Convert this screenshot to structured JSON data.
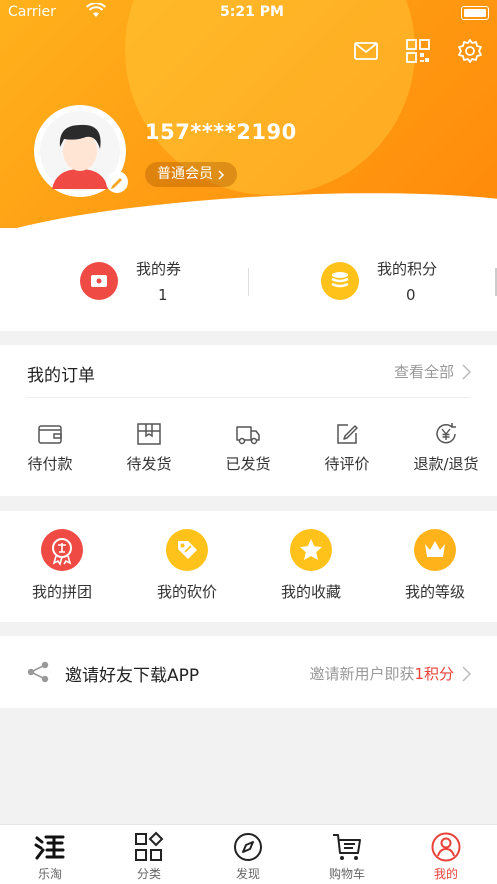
{
  "status_bar": {
    "carrier": "Carrier",
    "time": "5:21 PM"
  },
  "header": {
    "icons": [
      "mail-icon",
      "qr-code-icon",
      "settings-icon"
    ]
  },
  "profile": {
    "phone": "157****2190",
    "member_level": "普通会员"
  },
  "stats": [
    {
      "label": "我的券",
      "value": "1",
      "icon": "coupon-icon",
      "color": "#f04a45"
    },
    {
      "label": "我的积分",
      "value": "0",
      "icon": "coin-icon",
      "color": "#ffc21a"
    }
  ],
  "orders": {
    "title": "我的订单",
    "view_all": "查看全部",
    "items": [
      {
        "label": "待付款",
        "icon": "wallet-icon"
      },
      {
        "label": "待发货",
        "icon": "package-icon"
      },
      {
        "label": "已发货",
        "icon": "truck-icon"
      },
      {
        "label": "待评价",
        "icon": "edit-icon"
      },
      {
        "label": "退款/退货",
        "icon": "refund-icon"
      }
    ]
  },
  "features": [
    {
      "label": "我的拼团",
      "icon": "group-buy-icon",
      "color": "#f04a45"
    },
    {
      "label": "我的砍价",
      "icon": "price-tag-icon",
      "color": "#ffc21a"
    },
    {
      "label": "我的收藏",
      "icon": "star-icon",
      "color": "#ffc21a"
    },
    {
      "label": "我的等级",
      "icon": "crown-icon",
      "color": "#ffb21a"
    }
  ],
  "invite": {
    "title": "邀请好友下载APP",
    "desc_prefix": "邀请新用户即获",
    "desc_points": "1积分"
  },
  "tabbar": {
    "items": [
      {
        "label": "乐淘",
        "icon": "taobao-icon"
      },
      {
        "label": "分类",
        "icon": "category-icon"
      },
      {
        "label": "发现",
        "icon": "compass-icon"
      },
      {
        "label": "购物车",
        "icon": "cart-icon"
      },
      {
        "label": "我的",
        "icon": "profile-icon"
      }
    ],
    "active_index": 4
  },
  "colors": {
    "accent": "#ff9a12",
    "highlight": "#e8433a"
  }
}
